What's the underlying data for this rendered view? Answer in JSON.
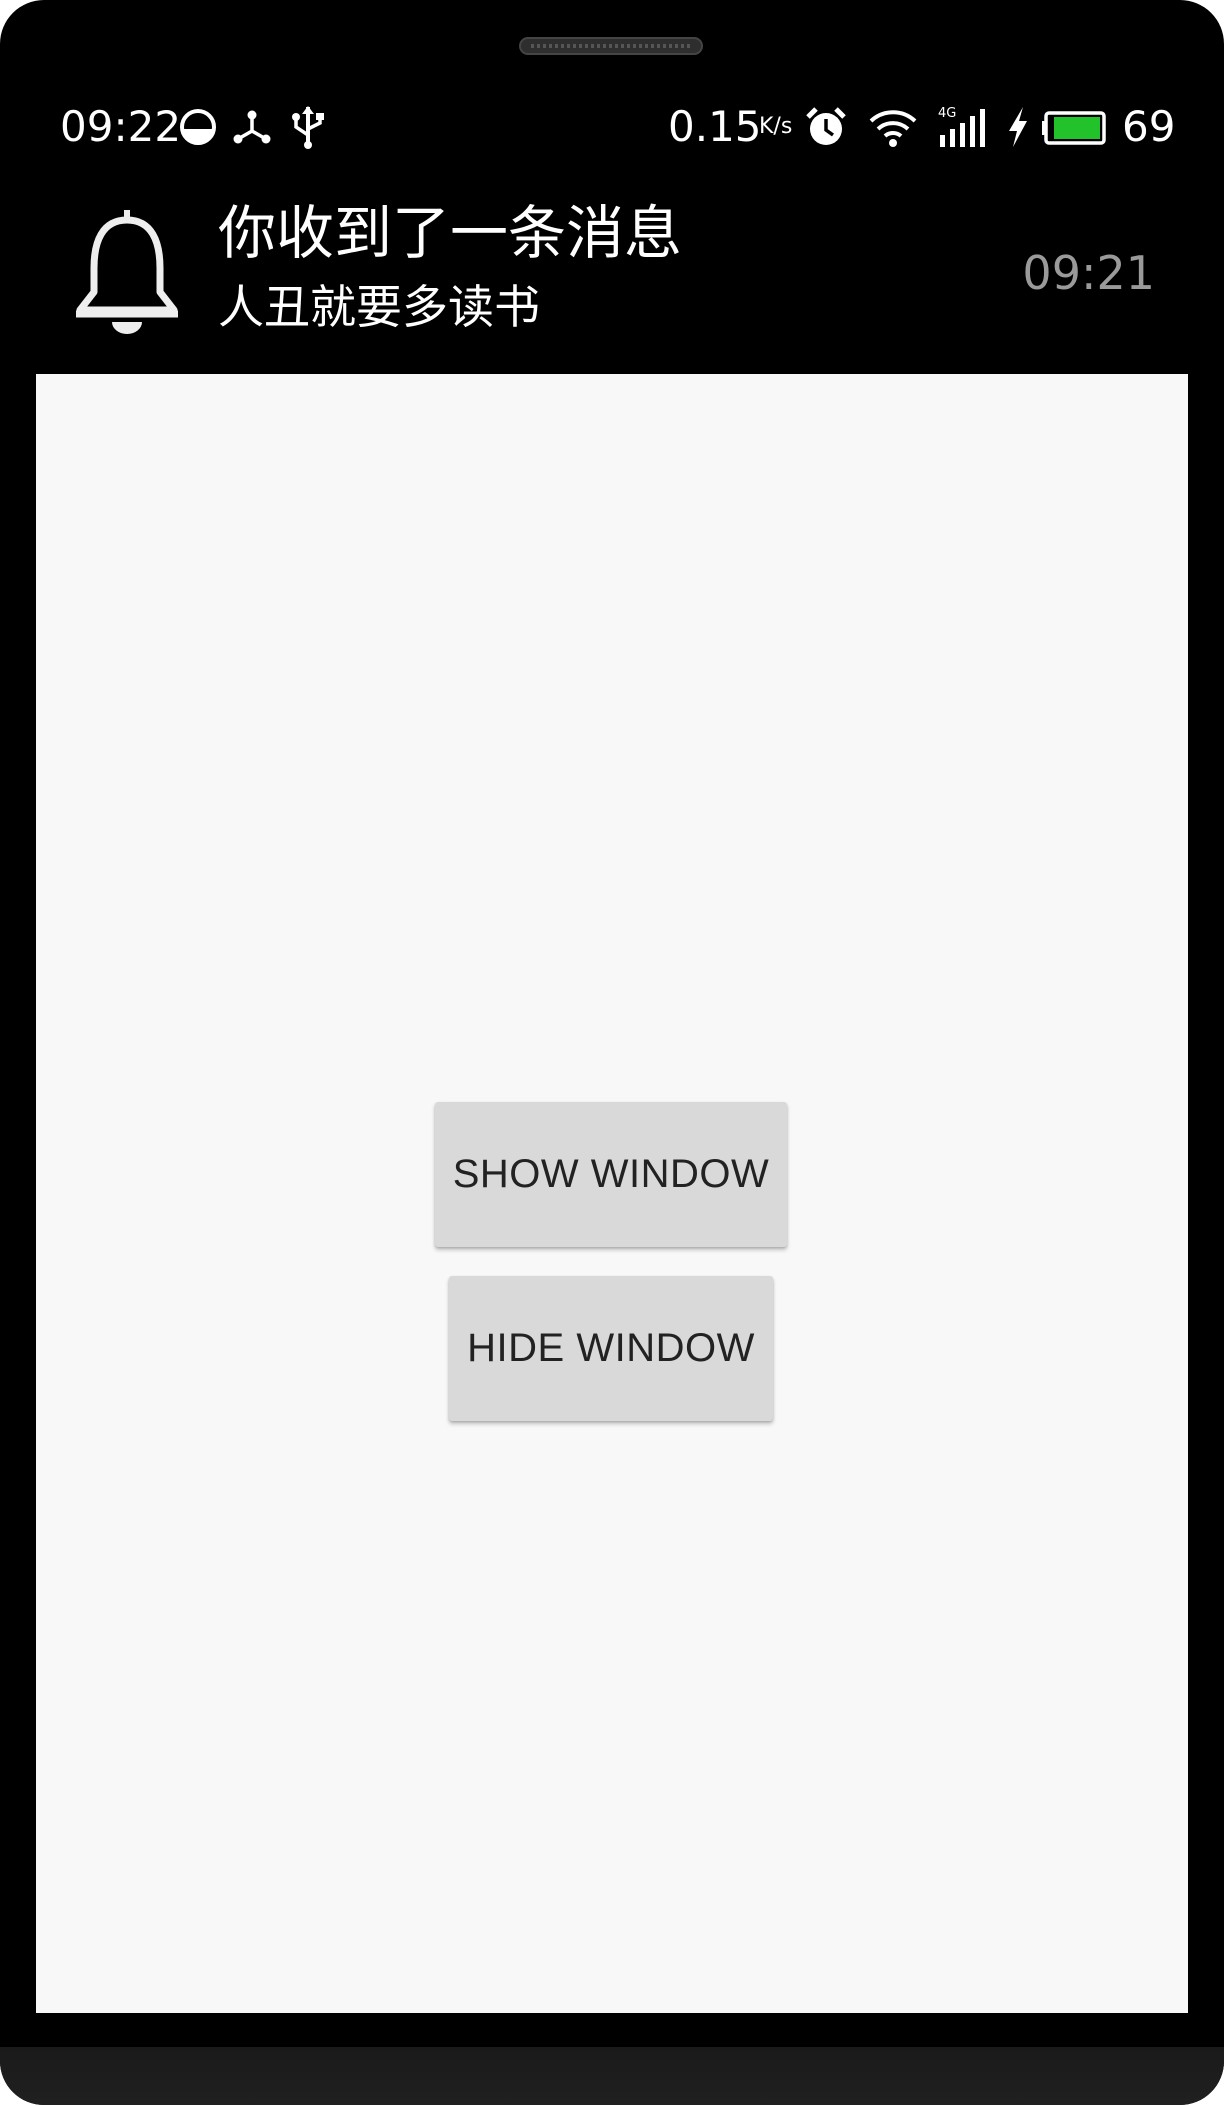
{
  "status_bar": {
    "time": "09:22",
    "network_speed": "0.15",
    "network_speed_unit": "K/s",
    "battery_percent": "69",
    "battery_color": "#22c22a",
    "icons": [
      "data-saver-icon",
      "share-icon",
      "usb-icon",
      "alarm-icon",
      "wifi-icon",
      "signal-4g-icon",
      "charging-icon",
      "battery-icon"
    ]
  },
  "notification": {
    "icon": "bell-icon",
    "title": "你收到了一条消息",
    "text": "人丑就要多读书",
    "time": "09:21"
  },
  "app": {
    "show_window_label": "SHOW WINDOW",
    "hide_window_label": "HIDE WINDOW"
  }
}
